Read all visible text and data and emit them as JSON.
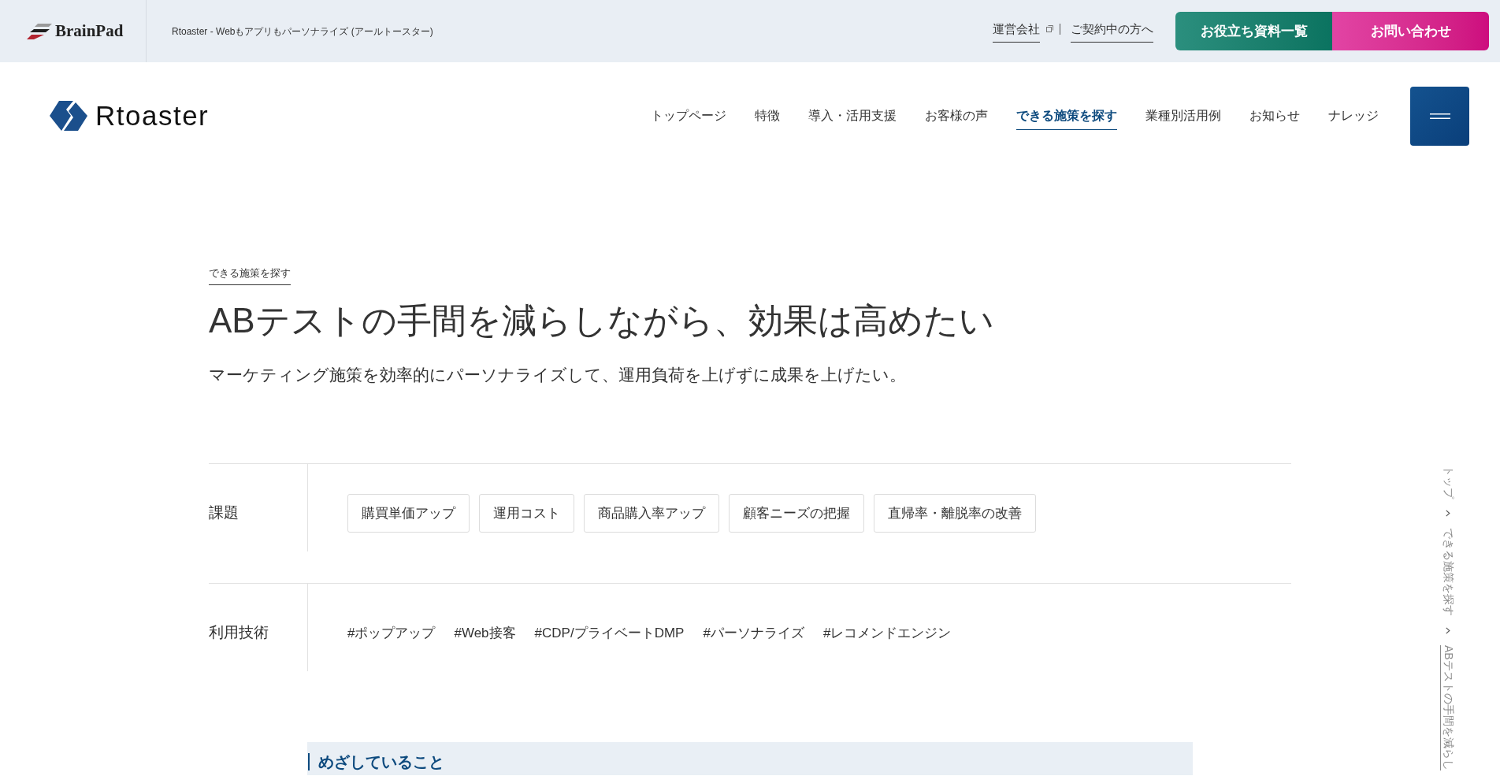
{
  "top_bar": {
    "brand": "BrainPad",
    "site_title": "Rtoaster - Webもアプリもパーソナライズ (アールトースター)",
    "links": [
      {
        "label": "運営会社",
        "external": true
      },
      {
        "label": "ご契約中の方へ",
        "external": false
      }
    ],
    "buttons": [
      {
        "label": "お役立ち資料一覧",
        "kind": "resources"
      },
      {
        "label": "お問い合わせ",
        "kind": "contact"
      }
    ]
  },
  "header": {
    "logo": "Rtoaster",
    "nav": [
      {
        "label": "トップページ",
        "selected": false
      },
      {
        "label": "特徴",
        "selected": false
      },
      {
        "label": "導入・活用支援",
        "selected": false
      },
      {
        "label": "お客様の声",
        "selected": false
      },
      {
        "label": "できる施策を探す",
        "selected": true
      },
      {
        "label": "業種別活用例",
        "selected": false
      },
      {
        "label": "お知らせ",
        "selected": false
      },
      {
        "label": "ナレッジ",
        "selected": false
      }
    ]
  },
  "page": {
    "category": "できる施策を探す",
    "title": "ABテストの手間を減らしながら、効果は高めたい",
    "lead": "マーケティング施策を効率的にパーソナライズして、運用負荷を上げずに成果を上げたい。",
    "attributes": [
      {
        "label": "課題",
        "kind": "tags",
        "items": [
          "購買単価アップ",
          "運用コスト",
          "商品購入率アップ",
          "顧客ニーズの把握",
          "直帰率・離脱率の改善"
        ]
      },
      {
        "label": "利用技術",
        "kind": "hashtags",
        "items": [
          "#ポップアップ",
          "#Web接客",
          "#CDP/プライベートDMP",
          "#パーソナライズ",
          "#レコメンドエンジン"
        ]
      }
    ],
    "section_heading": "めざしていること"
  },
  "breadcrumb": [
    {
      "label": "トップ",
      "selected": false
    },
    {
      "label": "できる施策を探す",
      "selected": false
    },
    {
      "label": "ABテストの手間を減らし",
      "selected": true
    }
  ]
}
